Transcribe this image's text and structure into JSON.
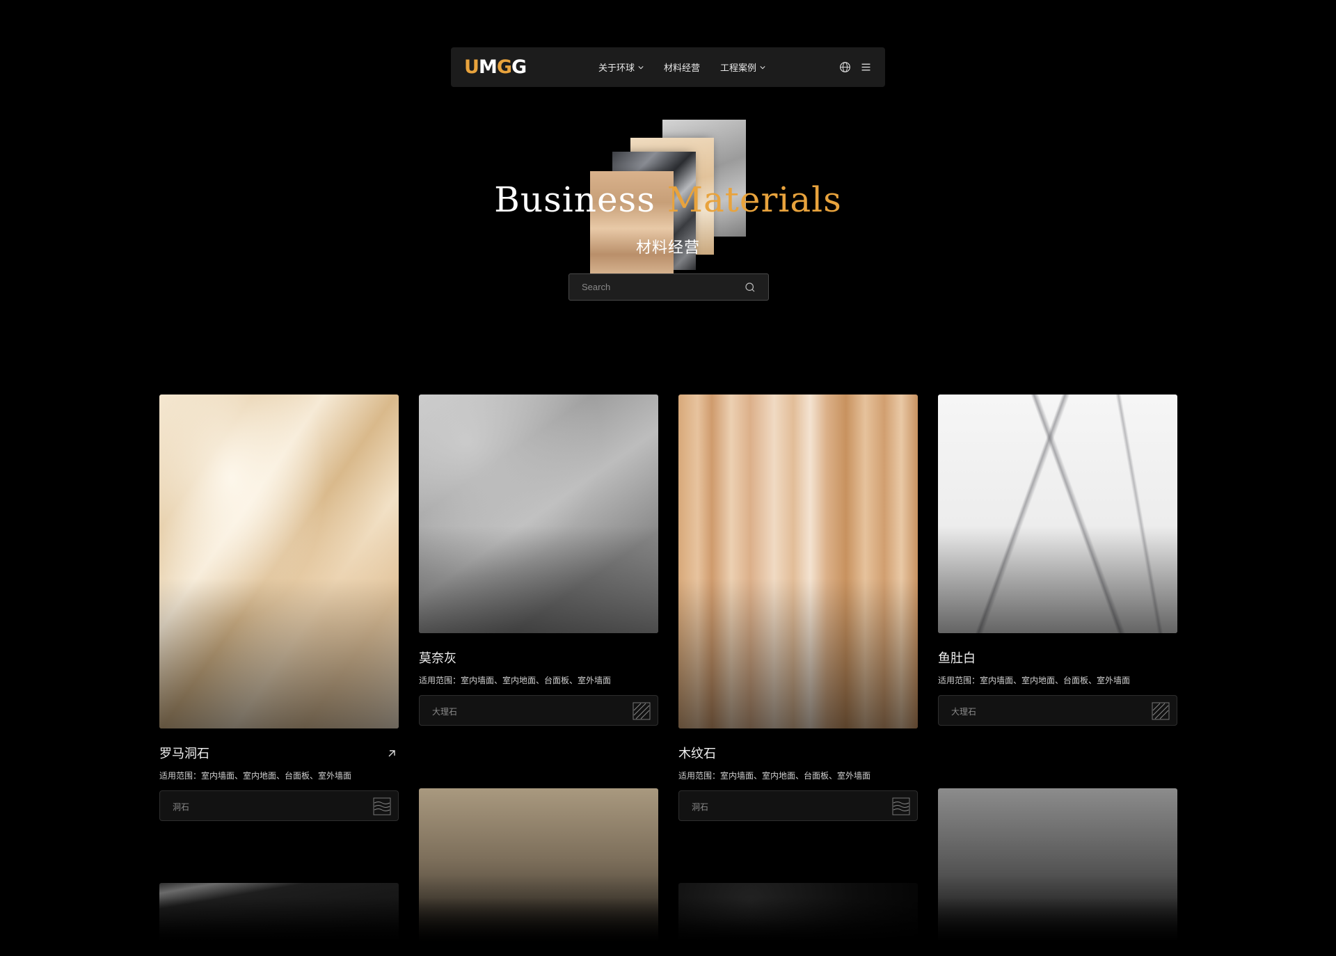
{
  "nav": {
    "logo": {
      "letters": [
        "U",
        "M",
        "G",
        "G"
      ],
      "colors": [
        "#e8a33d",
        "#ffffff",
        "#e8a33d",
        "#ffffff"
      ]
    },
    "items": [
      {
        "label": "关于环球",
        "has_dropdown": true
      },
      {
        "label": "材料经营",
        "has_dropdown": false
      },
      {
        "label": "工程案例",
        "has_dropdown": true
      }
    ],
    "icons": [
      "globe-icon",
      "menu-icon"
    ]
  },
  "hero": {
    "title_part1": "Business",
    "title_part2": "Materials",
    "accent_color": "#e8a33d",
    "subtitle": "材料经营"
  },
  "search": {
    "placeholder": "Search",
    "value": ""
  },
  "materials": [
    {
      "name": "罗马洞石",
      "scope": "适用范围：室内墙面、室内地面、台面板、室外墙面",
      "category": "洞石",
      "texture": "travertine"
    },
    {
      "name": "莫奈灰",
      "scope": "适用范围：室内墙面、室内地面、台面板、室外墙面",
      "category": "大理石",
      "texture": "grey"
    },
    {
      "name": "木纹石",
      "scope": "适用范围：室内墙面、室内地面、台面板、室外墙面",
      "category": "洞石",
      "texture": "wood"
    },
    {
      "name": "鱼肚白",
      "scope": "适用范围：室内墙面、室内地面、台面板、室外墙面",
      "category": "大理石",
      "texture": "white"
    }
  ]
}
